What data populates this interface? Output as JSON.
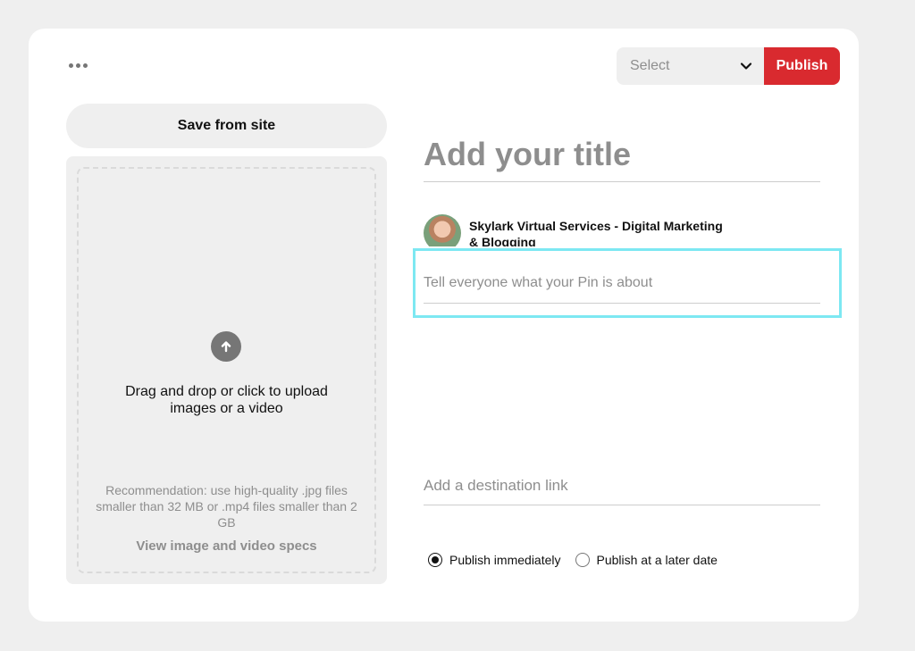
{
  "header": {
    "board_select": {
      "value": "Select",
      "icon": "chevron-down-icon"
    },
    "publish_label": "Publish",
    "more_icon": "ellipsis-icon",
    "accent_color": "#d92a2f"
  },
  "left_panel": {
    "save_from_site_label": "Save from site",
    "upload": {
      "icon": "arrow-up-circle-icon",
      "text": "Drag and drop or click to upload images or a video",
      "recommendation": "Recommendation: use high-quality .jpg files smaller than 32 MB or .mp4 files smaller than 2 GB",
      "specs_link": "View image and video specs"
    }
  },
  "form": {
    "title_placeholder": "Add your title",
    "profile_name": "Skylark Virtual Services - Digital Marketing & Blogging",
    "description_placeholder": "Tell everyone what your Pin is about",
    "link_placeholder": "Add a destination link",
    "highlight_color": "#7de8f2",
    "publish_options": [
      {
        "label": "Publish immediately",
        "checked": true
      },
      {
        "label": "Publish at a later date",
        "checked": false
      }
    ]
  }
}
